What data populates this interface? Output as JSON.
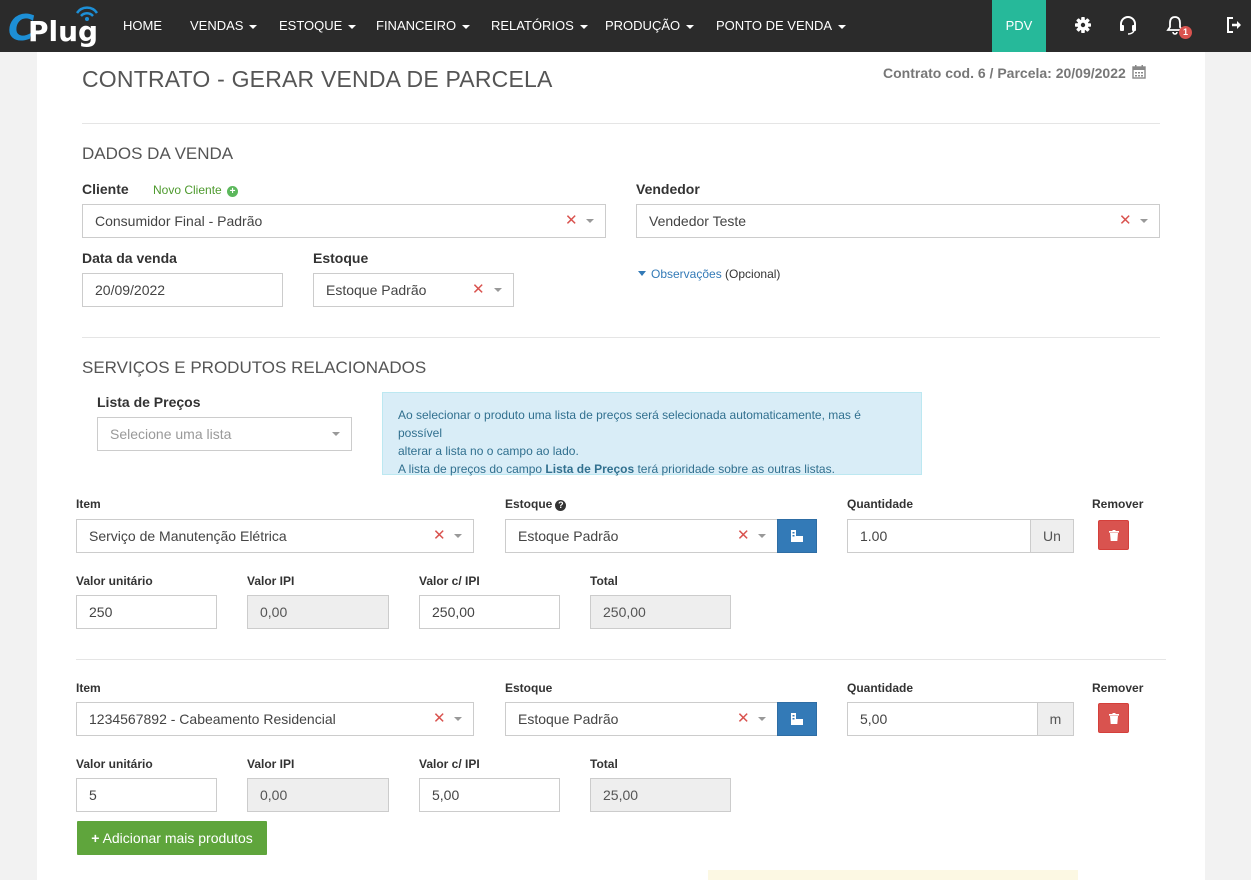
{
  "nav": {
    "logo_c": "C",
    "logo_plug": "Plug",
    "items": [
      {
        "label": "HOME",
        "caret": false
      },
      {
        "label": "VENDAS",
        "caret": true
      },
      {
        "label": "ESTOQUE",
        "caret": true
      },
      {
        "label": "FINANCEIRO",
        "caret": true
      },
      {
        "label": "RELATÓRIOS",
        "caret": true
      },
      {
        "label": "PRODUÇÃO",
        "caret": true
      },
      {
        "label": "PONTO DE VENDA",
        "caret": true
      }
    ],
    "pdv": "PDV",
    "notifications_count": "1",
    "icons": [
      "gear-icon",
      "headset-icon",
      "bell-icon",
      "sign-out-icon"
    ]
  },
  "page": {
    "title": "CONTRATO - GERAR VENDA DE PARCELA",
    "contract_info": "Contrato cod. 6 / Parcela: 20/09/2022"
  },
  "sale": {
    "section_title": "DADOS DA VENDA",
    "client_label": "Cliente",
    "new_client": "Novo Cliente",
    "client_value": "Consumidor Final - Padrão",
    "seller_label": "Vendedor",
    "seller_value": "Vendedor Teste",
    "date_label": "Data da venda",
    "date_value": "20/09/2022",
    "stock_label": "Estoque",
    "stock_value": "Estoque Padrão",
    "obs_link": "Observações",
    "obs_optional": "(Opcional)"
  },
  "products": {
    "section_title": "SERVIÇOS E PRODUTOS RELACIONADOS",
    "price_list_label": "Lista de Preços",
    "price_list_placeholder": "Selecione uma lista",
    "alert_line1": "Ao selecionar o produto uma lista de preços será selecionada automaticamente, mas é possível",
    "alert_line2": "alterar a lista no o campo ao lado.",
    "alert_line3_pre": "A lista de preços do campo ",
    "alert_line3_bold": "Lista de Preços",
    "alert_line3_post": " terá prioridade sobre as outras listas.",
    "item_label": "Item",
    "stock_label": "Estoque",
    "qty_label": "Quantidade",
    "remove_label": "Remover",
    "unit_value_label": "Valor unitário",
    "ipi_label": "Valor IPI",
    "value_ipi_label": "Valor c/ IPI",
    "total_label": "Total",
    "rows": [
      {
        "item": "Serviço de Manutenção Elétrica",
        "stock": "Estoque Padrão",
        "qty": "1.00",
        "unit": "Un",
        "unit_value": "250",
        "ipi": "0,00",
        "value_ipi": "250,00",
        "total": "250,00"
      },
      {
        "item": "1234567892 - Cabeamento Residencial",
        "stock": "Estoque Padrão",
        "qty": "5,00",
        "unit": "m",
        "unit_value": "5",
        "ipi": "0,00",
        "value_ipi": "5,00",
        "total": "25,00"
      }
    ],
    "add_more": "Adicionar mais produtos"
  },
  "colors": {
    "navbar": "#2b2b2b",
    "pdv": "#26b99a",
    "primary": "#337ab7",
    "danger": "#d9534f",
    "success": "#5fa53c"
  }
}
